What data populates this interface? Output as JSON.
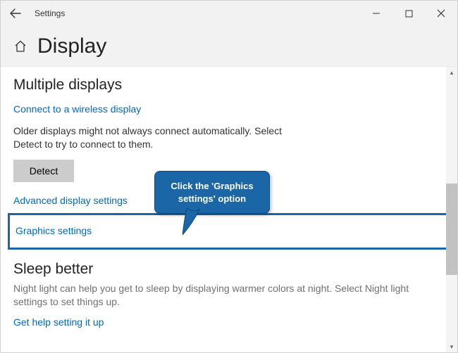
{
  "window": {
    "title": "Settings"
  },
  "page": {
    "title": "Display"
  },
  "multiple_displays": {
    "heading": "Multiple displays",
    "wireless_link": "Connect to a wireless display",
    "older_text": "Older displays might not always connect automatically. Select Detect to try to connect to them.",
    "detect_label": "Detect",
    "advanced_link": "Advanced display settings",
    "graphics_link": "Graphics settings"
  },
  "sleep_better": {
    "heading": "Sleep better",
    "desc": "Night light can help you get to sleep by displaying warmer colors at night. Select Night light settings to set things up.",
    "help_link": "Get help setting it up"
  },
  "callout": {
    "text": "Click the 'Graphics settings' option"
  }
}
